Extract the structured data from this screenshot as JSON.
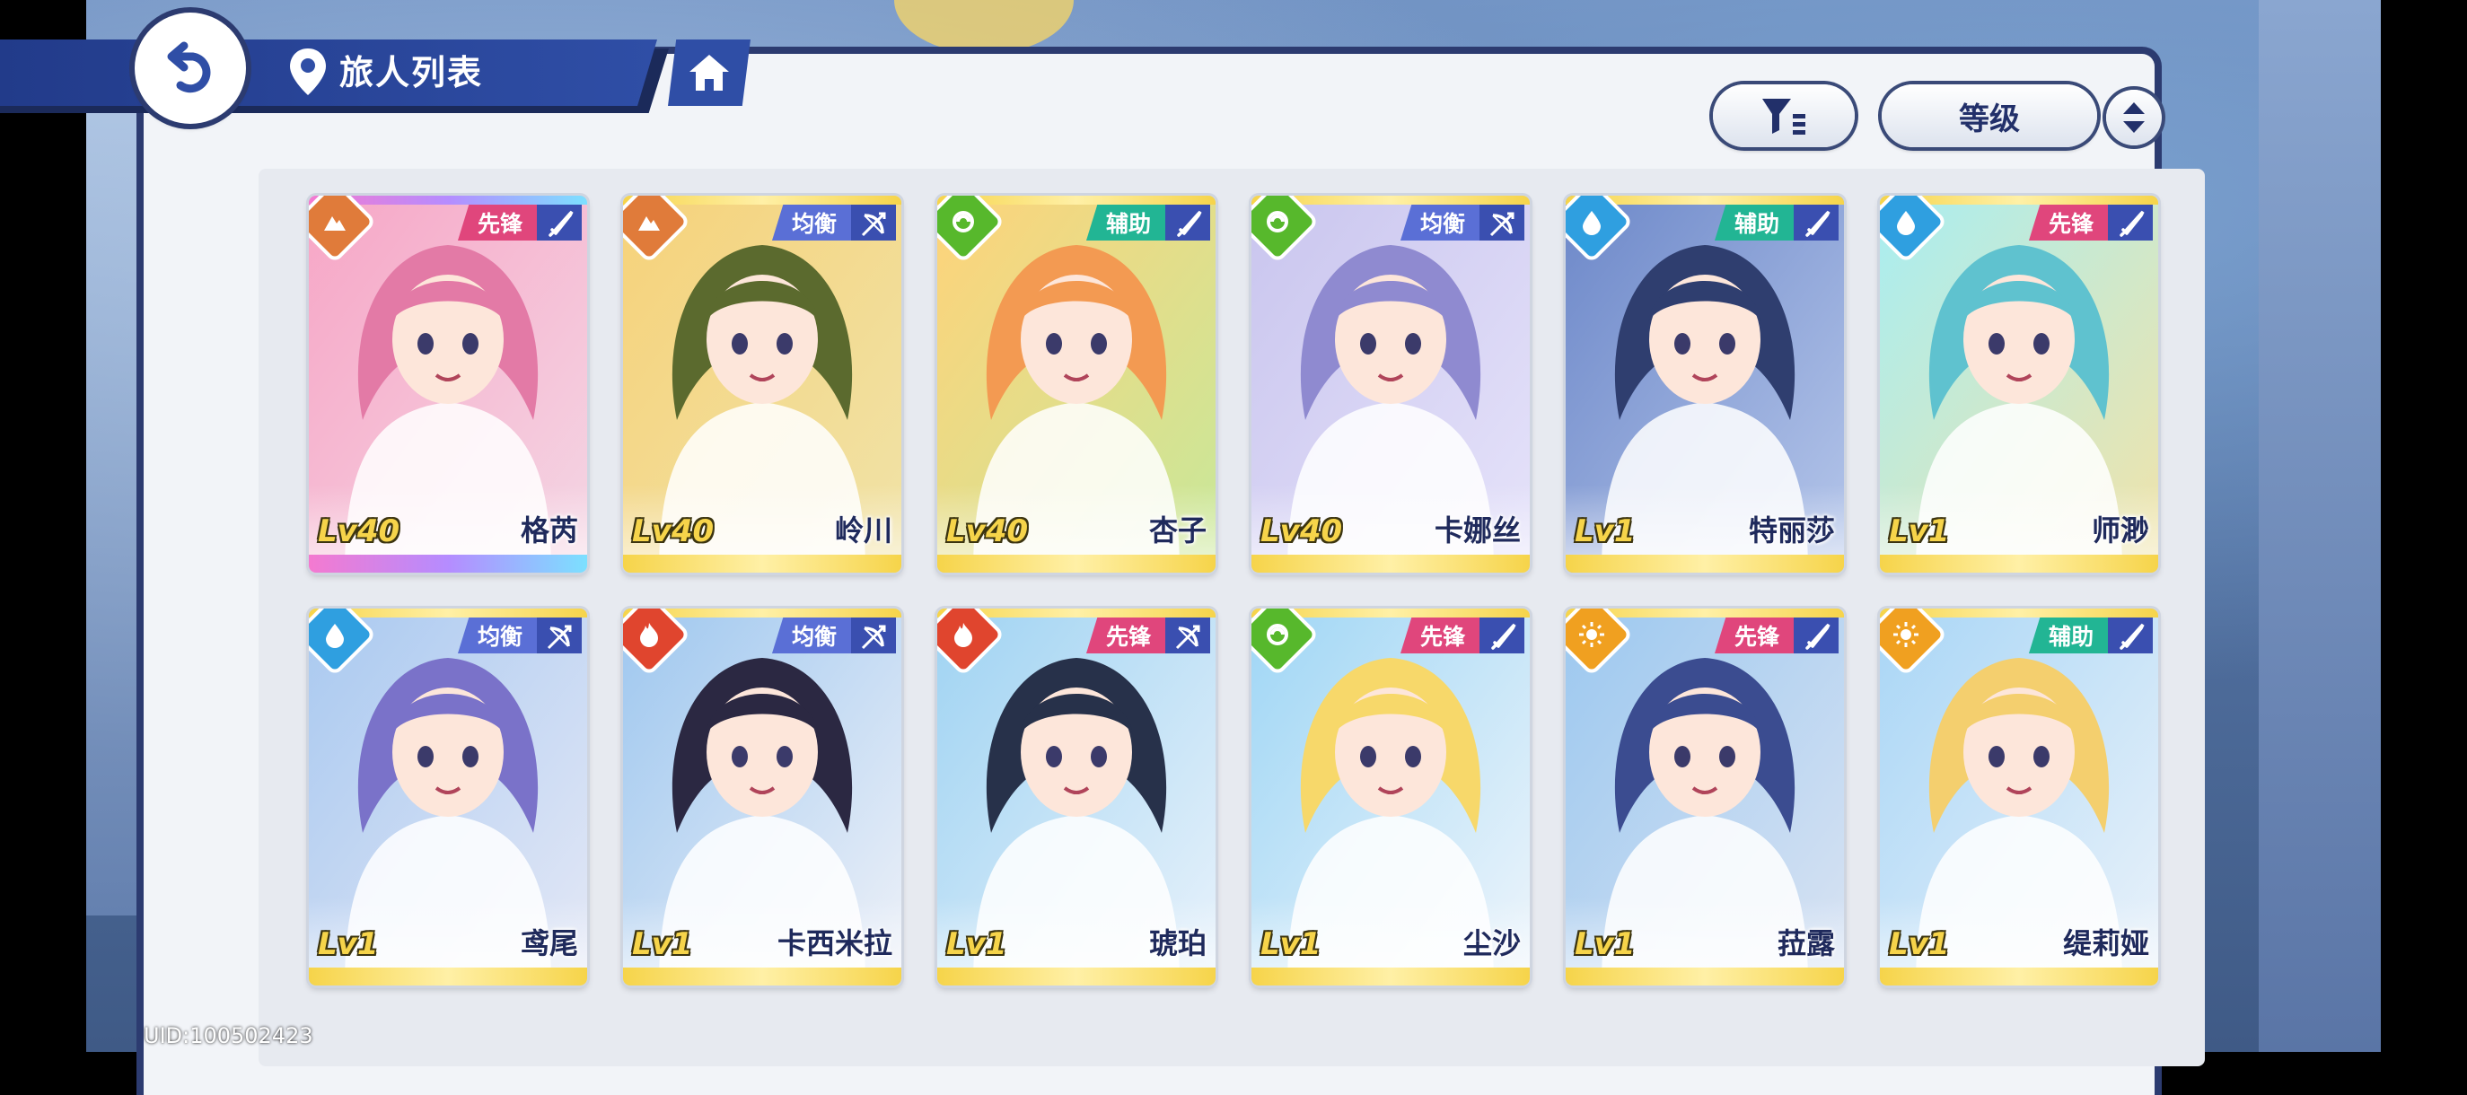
{
  "header": {
    "title": "旅人列表"
  },
  "toolbar": {
    "sort_label": "等级"
  },
  "icons": {
    "back": "back-arrow-icon",
    "location": "location-pin-icon",
    "home": "home-icon",
    "filter": "filter-icon",
    "sort_order": "sort-order-icon"
  },
  "colors": {
    "accent": "#2f4ea6",
    "role_vanguard": "#e0467c",
    "role_balance": "#5a6fd6",
    "role_support": "#22b594",
    "elem_earth": "#e07b3a",
    "elem_wind": "#57b82c",
    "elem_water": "#2f9fe0",
    "elem_fire": "#e0452e",
    "elem_light": "#f0a020"
  },
  "characters": [
    {
      "name": "格芮",
      "level": "Lv40",
      "role": "先锋",
      "weapon": "sword",
      "element": "earth",
      "rarity": "ur"
    },
    {
      "name": "岭川",
      "level": "Lv40",
      "role": "均衡",
      "weapon": "bow",
      "element": "earth",
      "rarity": "ssr"
    },
    {
      "name": "杏子",
      "level": "Lv40",
      "role": "辅助",
      "weapon": "sword",
      "element": "wind",
      "rarity": "ssr"
    },
    {
      "name": "卡娜丝",
      "level": "Lv40",
      "role": "均衡",
      "weapon": "bow",
      "element": "wind",
      "rarity": "ssr"
    },
    {
      "name": "特丽莎",
      "level": "Lv1",
      "role": "辅助",
      "weapon": "sword",
      "element": "water",
      "rarity": "ssr"
    },
    {
      "name": "师渺",
      "level": "Lv1",
      "role": "先锋",
      "weapon": "sword",
      "element": "water",
      "rarity": "ssr"
    },
    {
      "name": "鸢尾",
      "level": "Lv1",
      "role": "均衡",
      "weapon": "bow",
      "element": "water",
      "rarity": "ssr"
    },
    {
      "name": "卡西米拉",
      "level": "Lv1",
      "role": "均衡",
      "weapon": "bow",
      "element": "fire",
      "rarity": "ssr"
    },
    {
      "name": "琥珀",
      "level": "Lv1",
      "role": "先锋",
      "weapon": "bow",
      "element": "fire",
      "rarity": "ssr"
    },
    {
      "name": "尘沙",
      "level": "Lv1",
      "role": "先锋",
      "weapon": "sword",
      "element": "wind",
      "rarity": "ssr"
    },
    {
      "name": "菈露",
      "level": "Lv1",
      "role": "先锋",
      "weapon": "sword",
      "element": "light",
      "rarity": "ssr"
    },
    {
      "name": "缇莉娅",
      "level": "Lv1",
      "role": "辅助",
      "weapon": "sword",
      "element": "light",
      "rarity": "ssr"
    }
  ],
  "footer": {
    "uid": "UID:100502423"
  }
}
